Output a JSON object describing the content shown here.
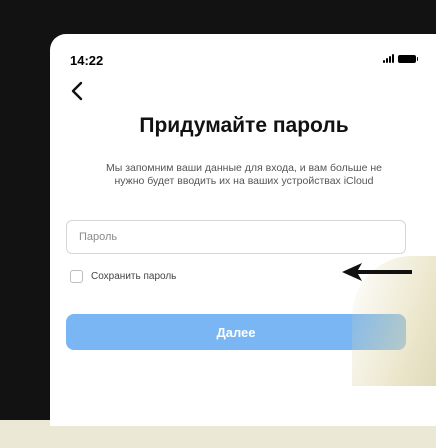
{
  "status_bar": {
    "time": "14:22",
    "icons": [
      "signal-icon",
      "battery-icon"
    ]
  },
  "nav": {
    "back_icon": "chevron-left-icon"
  },
  "page": {
    "title": "Придумайте пароль",
    "description": "Мы запомним ваши данные для входа, и вам больше не нужно будет вводить их на ваших устройствах iCloud"
  },
  "password_field": {
    "placeholder": "Пароль",
    "value": ""
  },
  "save_checkbox": {
    "label": "Сохранить пароль",
    "checked": false
  },
  "next_button": {
    "label": "Далее"
  },
  "colors": {
    "accent": "#79b6f3",
    "background": "#ffffff",
    "bezel": "#121212"
  }
}
